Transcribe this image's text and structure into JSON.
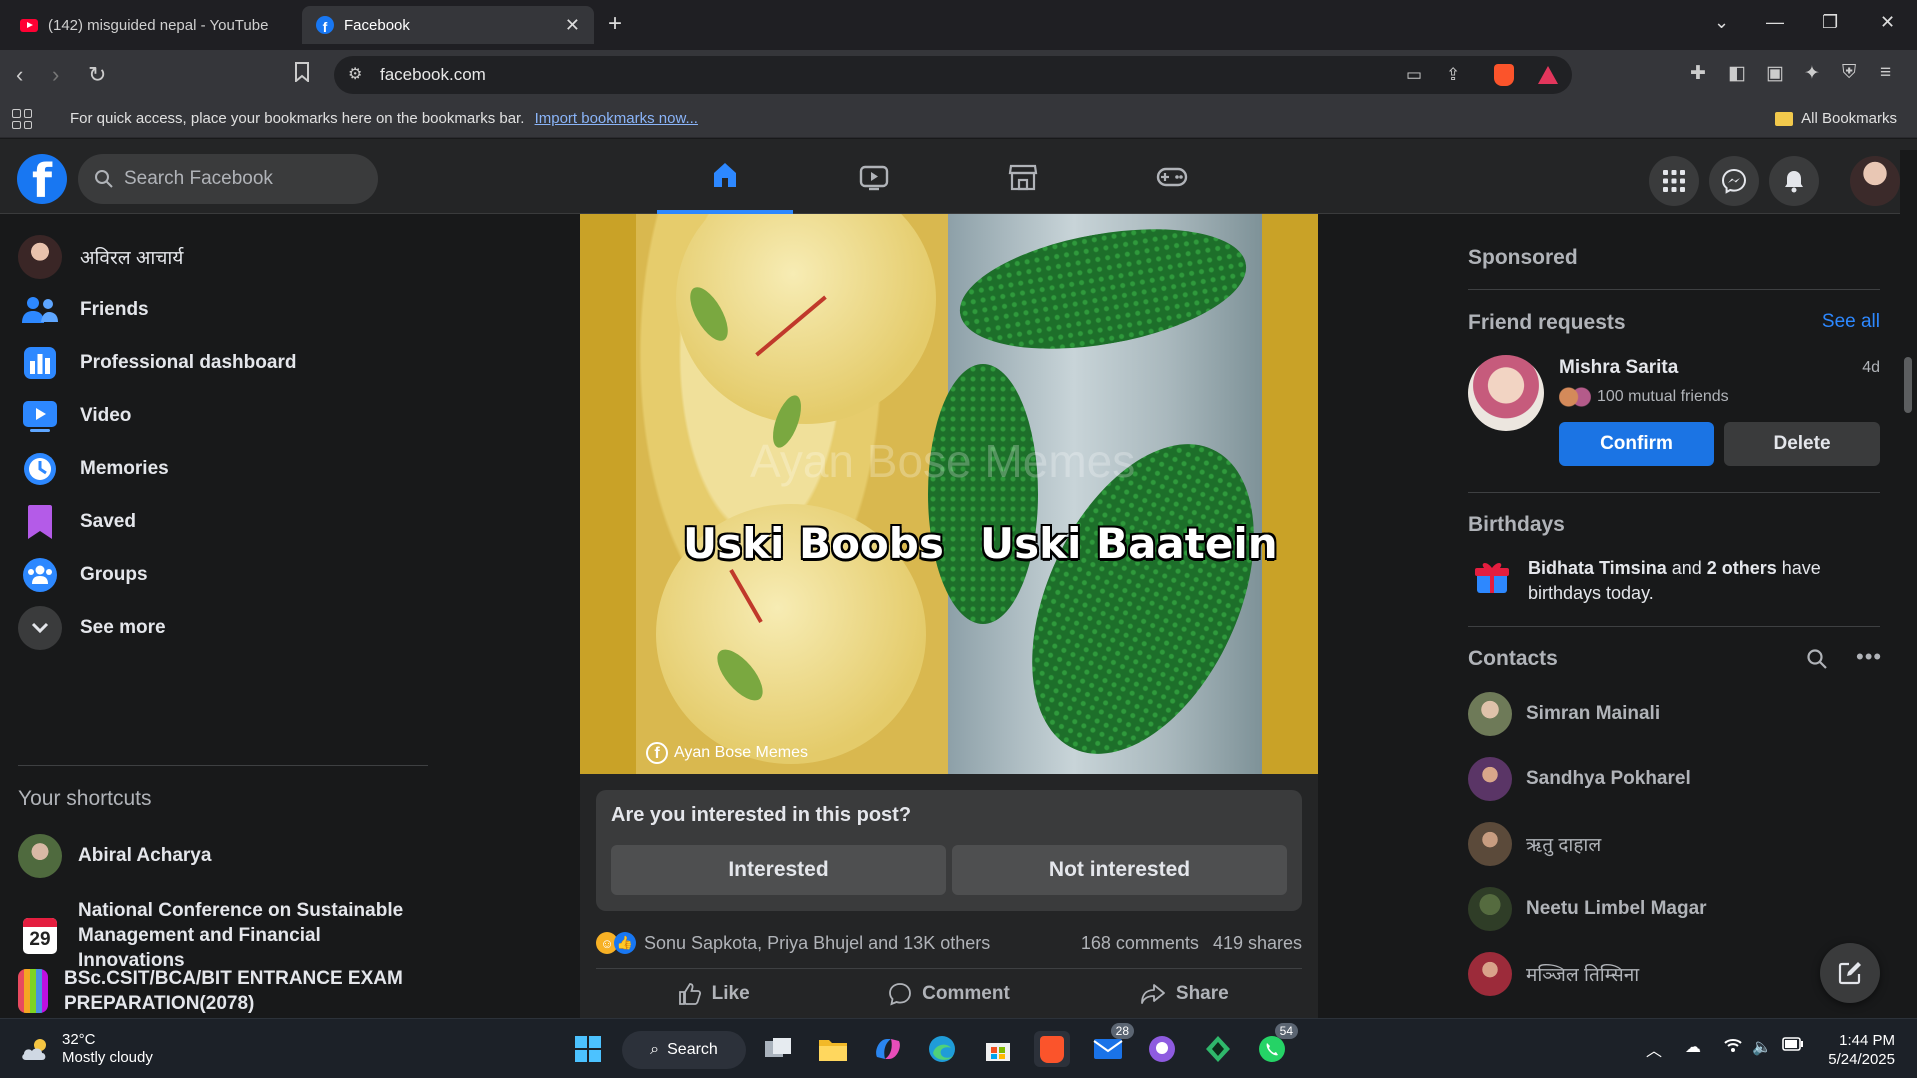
{
  "browser": {
    "tabs": [
      {
        "label": "(142) misguided nepal - YouTube"
      },
      {
        "label": "Facebook"
      }
    ],
    "url": "facebook.com",
    "bookmarks_hint": "For quick access, place your bookmarks here on the bookmarks bar.",
    "import_link": "Import bookmarks now...",
    "all_bookmarks": "All Bookmarks"
  },
  "fb_header": {
    "search_placeholder": "Search Facebook"
  },
  "left_nav": {
    "profile_name": "अविरल आचार्य",
    "items": [
      {
        "label": "Friends",
        "icon": "friends-icon"
      },
      {
        "label": "Professional dashboard",
        "icon": "dashboard-icon"
      },
      {
        "label": "Video",
        "icon": "video-icon"
      },
      {
        "label": "Memories",
        "icon": "memories-icon"
      },
      {
        "label": "Saved",
        "icon": "saved-icon"
      },
      {
        "label": "Groups",
        "icon": "groups-icon"
      }
    ],
    "see_more": "See more",
    "shortcuts_title": "Your shortcuts",
    "shortcuts": [
      {
        "label": "Abiral Acharya"
      },
      {
        "label": "National Conference on Sustainable Management and Financial Innovations"
      },
      {
        "label": "BSc.CSIT/BCA/BIT ENTRANCE EXAM PREPARATION(2078)"
      }
    ],
    "calendar_day": "29"
  },
  "post": {
    "meme_left": "Uski Boobs",
    "meme_right": "Uski Baatein",
    "watermark": "Ayan Bose Memes",
    "credit": "Ayan Bose Memes",
    "interest_question": "Are you interested in this post?",
    "interested": "Interested",
    "not_interested": "Not interested",
    "reactions_text": "Sonu Sapkota, Priya Bhujel and 13K others",
    "comments": "168 comments",
    "shares": "419 shares",
    "like": "Like",
    "comment": "Comment",
    "share": "Share"
  },
  "right_col": {
    "sponsored": "Sponsored",
    "friend_requests_title": "Friend requests",
    "see_all": "See all",
    "request": {
      "name": "Mishra Sarita",
      "age": "4d",
      "mutual": "100 mutual friends",
      "confirm": "Confirm",
      "delete": "Delete"
    },
    "birthdays_title": "Birthdays",
    "birthday_name": "Bidhata Timsina",
    "birthday_and": " and ",
    "birthday_others": "2 others",
    "birthday_rest": " have birthdays today.",
    "contacts_title": "Contacts",
    "contacts": [
      {
        "name": "Simran Mainali"
      },
      {
        "name": "Sandhya Pokharel"
      },
      {
        "name": "ऋतु दाहाल"
      },
      {
        "name": "Neetu Limbel Magar"
      },
      {
        "name": "मञ्जिल तिम्सिना"
      }
    ]
  },
  "taskbar": {
    "temperature": "32°C",
    "weather": "Mostly cloudy",
    "search": "Search",
    "mail_badge": "28",
    "whatsapp_badge": "54",
    "time": "1:44 PM",
    "date": "5/24/2025"
  },
  "colors": {
    "fb_blue": "#1877f2",
    "link_blue": "#2d88ff",
    "bg": "#18191a",
    "card": "#242526"
  }
}
